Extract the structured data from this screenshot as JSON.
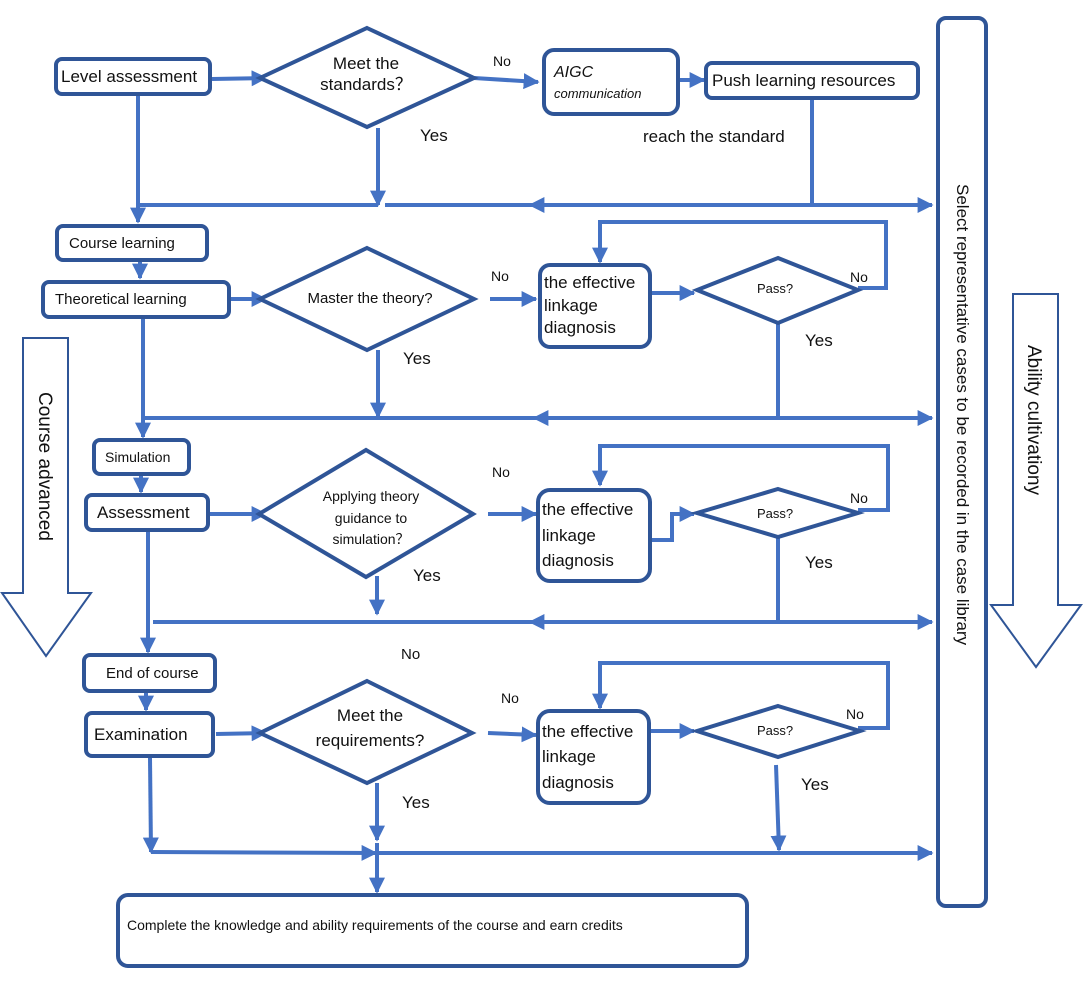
{
  "colors": {
    "node_border": "#2f5597",
    "connector": "#4472c4",
    "side_arrow": "#2f5597"
  },
  "side_arrows": {
    "left": "Course advanced",
    "right": "Ability cultivationy"
  },
  "case_library": "Select representative cases to be recorded in the case library",
  "stage1": {
    "start": "Level assessment",
    "decision": [
      "Meet the",
      "standards？"
    ],
    "no_label": "No",
    "yes_label": "Yes",
    "aigc": [
      "AIGC",
      "communication"
    ],
    "push": "Push learning resources",
    "reach": "reach the standard"
  },
  "stage2": {
    "course_learning": "Course learning",
    "theoretical": "Theoretical learning",
    "decision": "Master the theory?",
    "no_label": "No",
    "yes_label": "Yes",
    "diagnosis": [
      "the effective",
      "linkage",
      "diagnosis"
    ],
    "pass": "Pass?",
    "pass_no": "No",
    "pass_yes": "Yes"
  },
  "stage3": {
    "simulation": "Simulation",
    "assessment": "Assessment",
    "decision": [
      "Applying theory",
      "guidance to",
      "simulation？"
    ],
    "no_label": "No",
    "yes_label": "Yes",
    "diagnosis": [
      "the effective",
      "linkage",
      "diagnosis"
    ],
    "pass": "Pass?",
    "pass_no": "No",
    "pass_yes": "Yes"
  },
  "stage4": {
    "end_course": "End of course",
    "examination": "Examination",
    "decision": [
      "Meet the",
      "requirements?"
    ],
    "no_top_label": "No",
    "no_label": "No",
    "yes_label": "Yes",
    "diagnosis": [
      "the effective",
      "linkage",
      "diagnosis"
    ],
    "pass": "Pass?",
    "pass_no": "No",
    "pass_yes": "Yes"
  },
  "final": "Complete the knowledge and ability requirements of the course and earn credits"
}
